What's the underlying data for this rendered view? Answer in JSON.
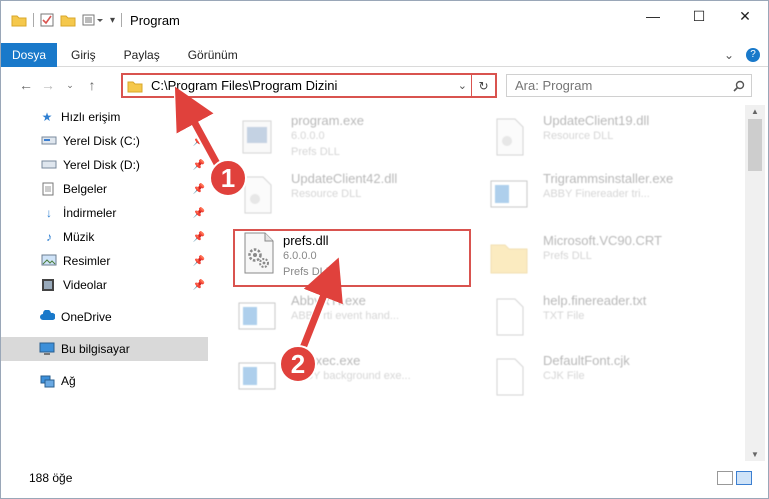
{
  "window": {
    "title": "Program"
  },
  "ribbon": {
    "tabs": [
      "Dosya",
      "Giriş",
      "Paylaş",
      "Görünüm"
    ]
  },
  "address": {
    "path": "C:\\Program Files\\Program Dizini"
  },
  "search": {
    "placeholder": "Ara: Program"
  },
  "sidebar": {
    "items": [
      {
        "label": "Hızlı erişim",
        "icon": "star-icon"
      },
      {
        "label": "Yerel Disk (C:)",
        "icon": "drive-icon"
      },
      {
        "label": "Yerel Disk (D:)",
        "icon": "drive-icon"
      },
      {
        "label": "Belgeler",
        "icon": "documents-icon"
      },
      {
        "label": "İndirmeler",
        "icon": "download-icon"
      },
      {
        "label": "Müzik",
        "icon": "music-icon"
      },
      {
        "label": "Resimler",
        "icon": "pictures-icon"
      },
      {
        "label": "Videolar",
        "icon": "video-icon"
      },
      {
        "label": "OneDrive",
        "icon": "cloud-icon"
      },
      {
        "label": "Bu bilgisayar",
        "icon": "computer-icon"
      },
      {
        "label": "Ağ",
        "icon": "network-icon"
      }
    ]
  },
  "files": [
    {
      "name": "program.exe",
      "l2": "6.0.0.0",
      "l3": "Prefs DLL"
    },
    {
      "name": "UpdateClient19.dll",
      "l2": "Resource DLL",
      "l3": ""
    },
    {
      "name": "UpdateClient42.dll",
      "l2": "Resource DLL",
      "l3": ""
    },
    {
      "name": "Trigrammsinstaller.exe",
      "l2": "ABBY Finereader tri...",
      "l3": ""
    },
    {
      "name": "prefs.dll",
      "l2": "6.0.0.0",
      "l3": "Prefs DLL"
    },
    {
      "name": "Microsoft.VC90.CRT",
      "l2": "Prefs DLL",
      "l3": ""
    },
    {
      "name": "AbbyRTI.exe",
      "l2": "ABBY rti event hand...",
      "l3": ""
    },
    {
      "name": "help.finereader.txt",
      "l2": "TXT File",
      "l3": ""
    },
    {
      "name": "BgExec.exe",
      "l2": "ABBY background exe...",
      "l3": ""
    },
    {
      "name": "DefaultFont.cjk",
      "l2": "CJK File",
      "l3": ""
    }
  ],
  "status": {
    "count": "188 öğe"
  },
  "annotations": {
    "step1": "1",
    "step2": "2"
  }
}
